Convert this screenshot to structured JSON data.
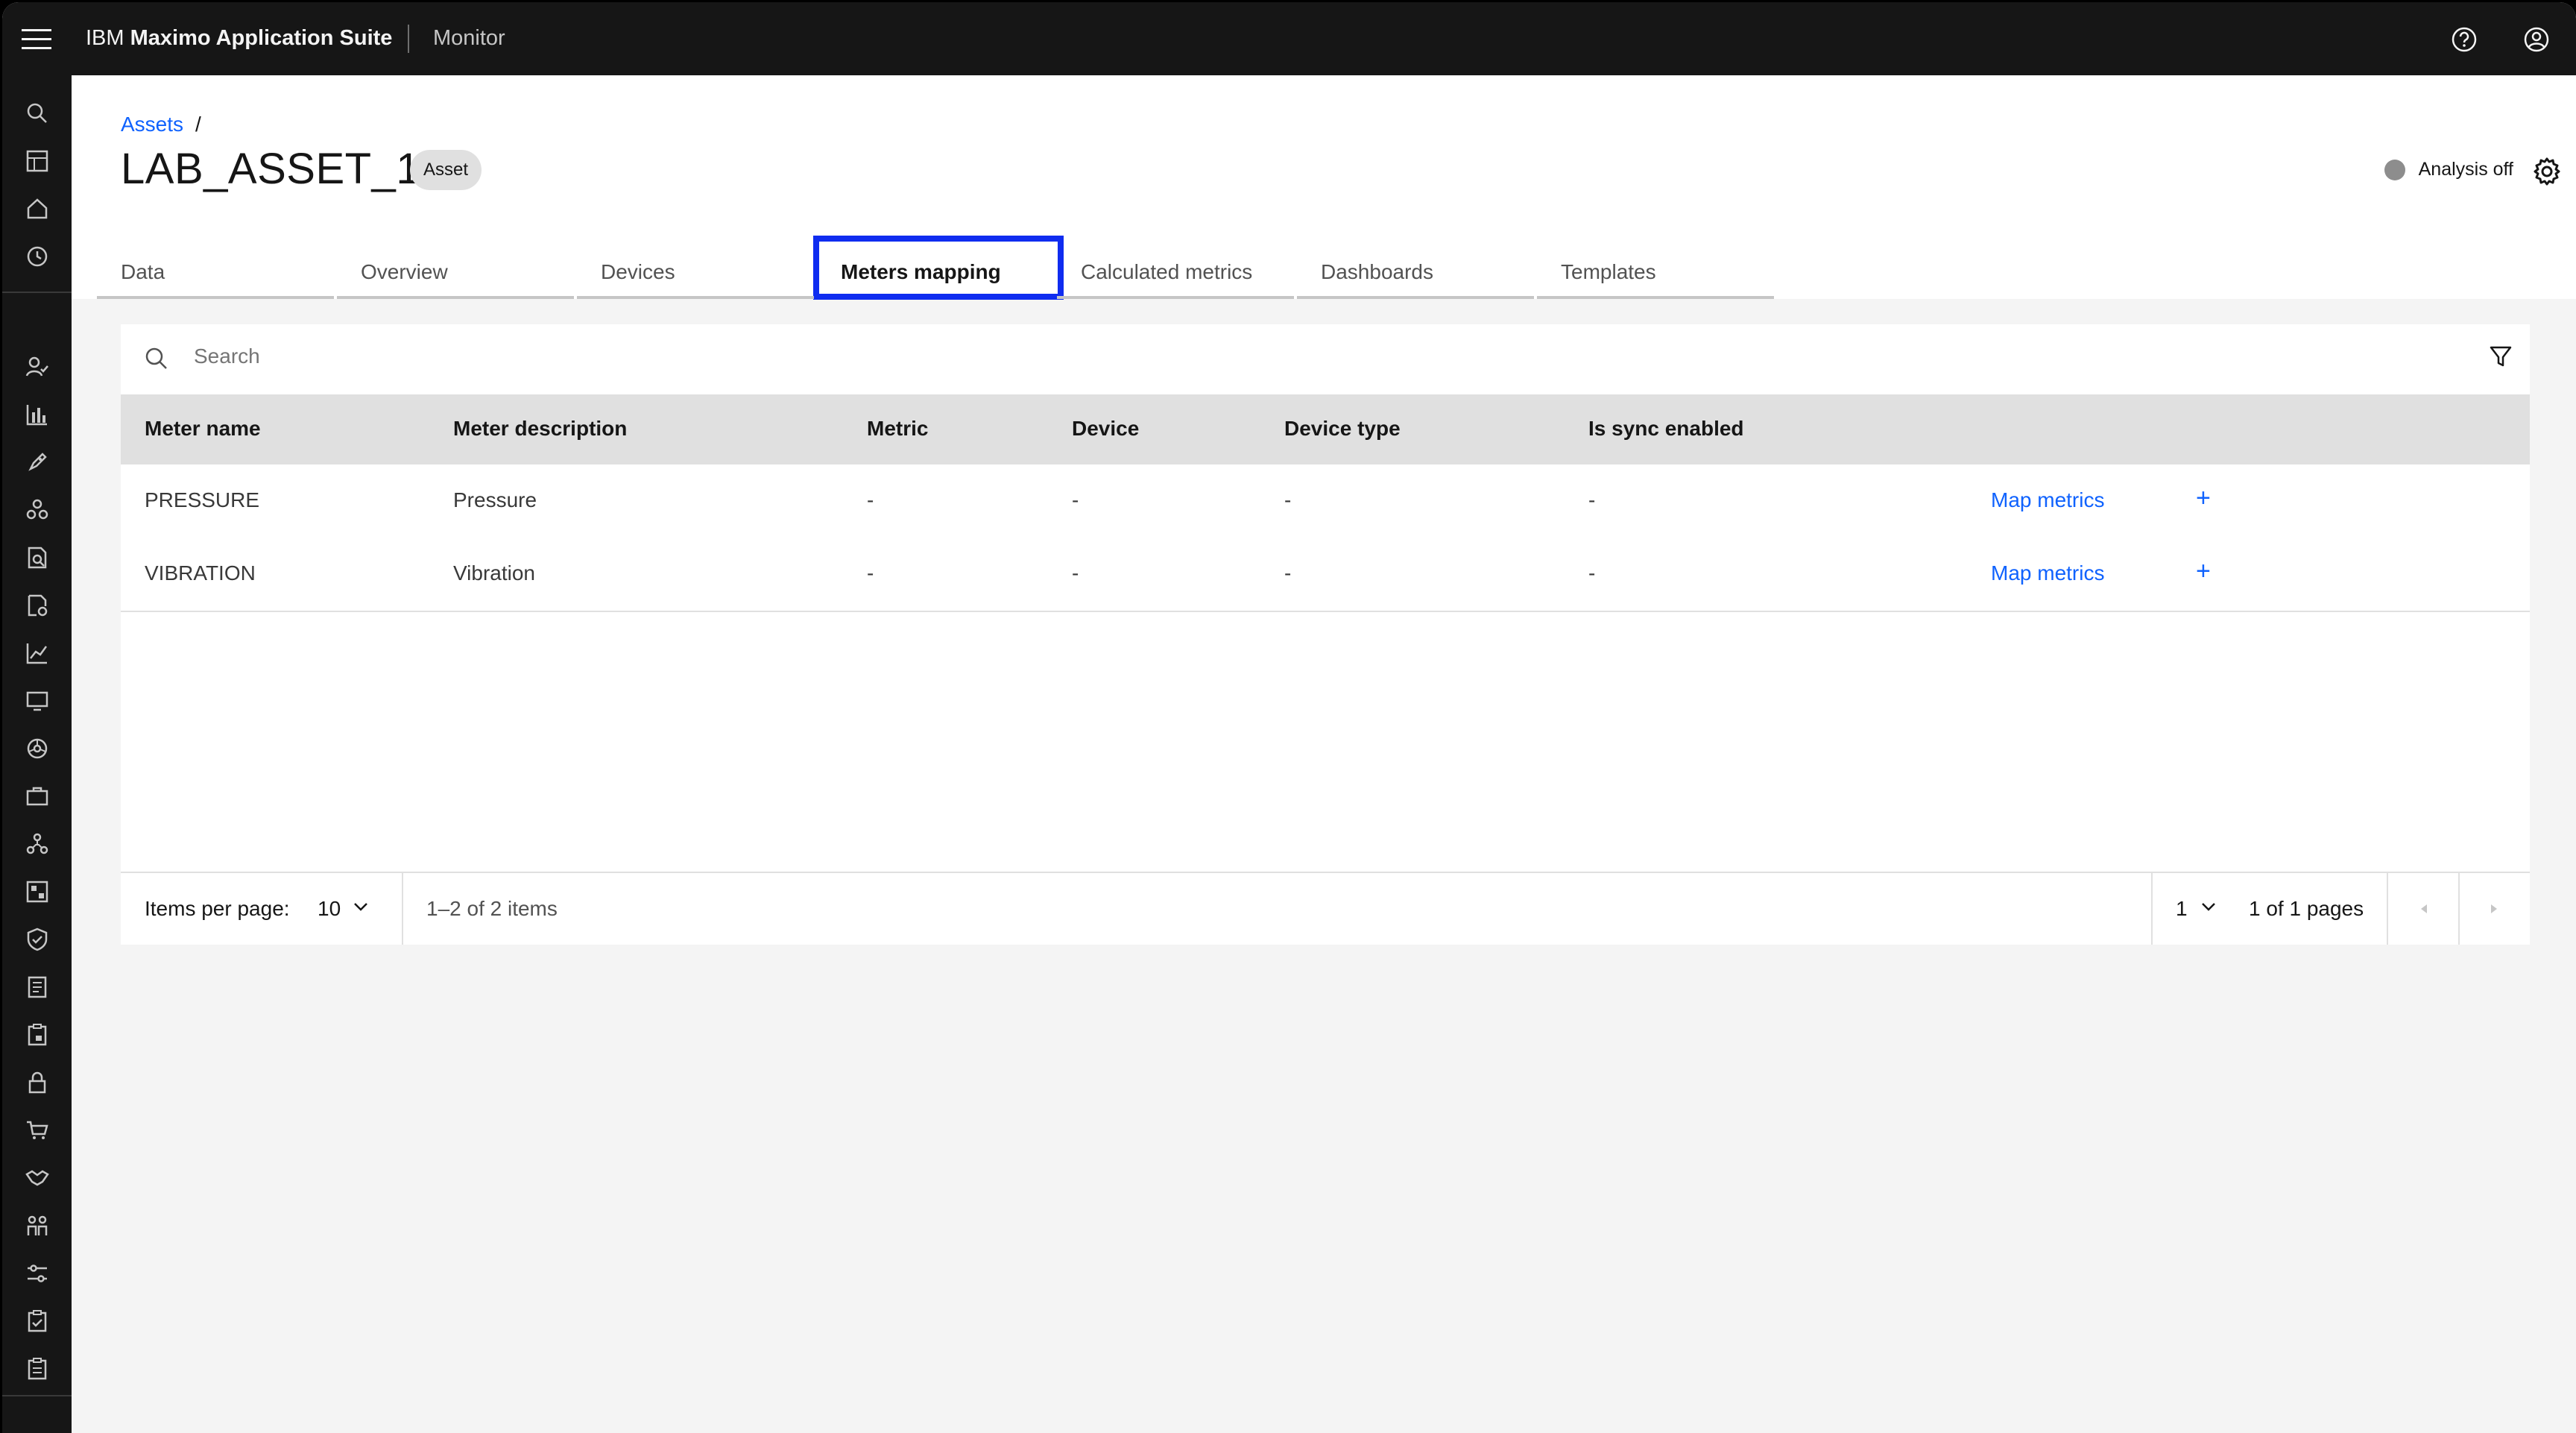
{
  "header": {
    "brand_prefix": "IBM",
    "brand_name": "Maximo Application Suite",
    "product": "Monitor"
  },
  "breadcrumb": {
    "link": "Assets",
    "separator": "/"
  },
  "page": {
    "title": "LAB_ASSET_1",
    "tag": "Asset",
    "analysis_status": "Analysis off"
  },
  "tabs": [
    {
      "label": "Data"
    },
    {
      "label": "Overview"
    },
    {
      "label": "Devices"
    },
    {
      "label": "Meters mapping"
    },
    {
      "label": "Calculated metrics"
    },
    {
      "label": "Dashboards"
    },
    {
      "label": "Templates"
    }
  ],
  "active_tab": "Meters mapping",
  "search": {
    "placeholder": "Search"
  },
  "table": {
    "columns": [
      "Meter name",
      "Meter description",
      "Metric",
      "Device",
      "Device type",
      "Is sync enabled"
    ],
    "rows": [
      {
        "name": "PRESSURE",
        "description": "Pressure",
        "metric": "-",
        "device": "-",
        "device_type": "-",
        "sync": "-",
        "action": "Map metrics",
        "action_icon": "+"
      },
      {
        "name": "VIBRATION",
        "description": "Vibration",
        "metric": "-",
        "device": "-",
        "device_type": "-",
        "sync": "-",
        "action": "Map metrics",
        "action_icon": "+"
      }
    ]
  },
  "pagination": {
    "items_per_page_label": "Items per page:",
    "items_per_page_value": "10",
    "range_text": "1–2 of 2 items",
    "page_value": "1",
    "pages_text": "1 of 1 pages"
  },
  "colors": {
    "header_bg": "#161616",
    "link": "#0f62fe",
    "highlight": "#0f2cf0",
    "status_dot": "#8d8d8d"
  },
  "icons": {
    "rail": [
      "search-icon",
      "workspace-icon",
      "home-icon",
      "history-icon",
      "user-check-icon",
      "bar-chart-icon",
      "rocket-icon",
      "cluster-icon",
      "document-search-icon",
      "document-settings-icon",
      "line-chart-icon",
      "screen-icon",
      "wheel-icon",
      "toolbox-icon",
      "network-icon",
      "calendar-grid-icon",
      "shield-icon",
      "ledger-icon",
      "clipboard-lock-icon",
      "lock-icon",
      "cart-icon",
      "handshake-icon",
      "people-icon",
      "sliders-icon",
      "checklist-icon",
      "clipboard-icon"
    ]
  }
}
